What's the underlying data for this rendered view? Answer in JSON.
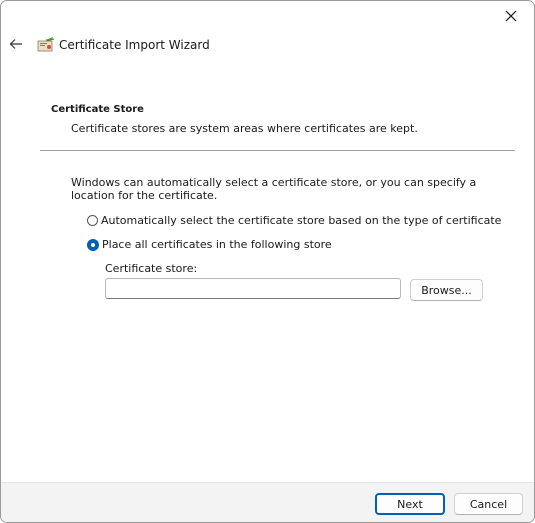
{
  "window": {
    "title": "Certificate Import Wizard",
    "icons": {
      "back": "back-arrow-icon",
      "close": "close-icon",
      "app": "certificate-icon"
    }
  },
  "section": {
    "title": "Certificate Store",
    "description": "Certificate stores are system areas where certificates are kept."
  },
  "body": {
    "intro": "Windows can automatically select a certificate store, or you can specify a location for the certificate.",
    "options": [
      {
        "label": "Automatically select the certificate store based on the type of certificate",
        "selected": false
      },
      {
        "label": "Place all certificates in the following store",
        "selected": true
      }
    ],
    "store_label": "Certificate store:",
    "store_value": "",
    "browse_label": "Browse..."
  },
  "footer": {
    "next_label": "Next",
    "cancel_label": "Cancel"
  },
  "colors": {
    "accent": "#005fb8",
    "footer_bg": "#f3f3f3"
  }
}
